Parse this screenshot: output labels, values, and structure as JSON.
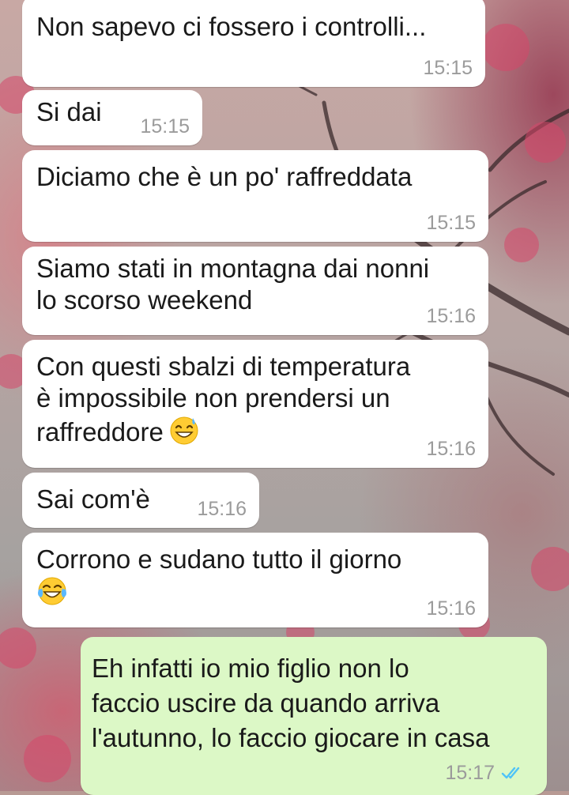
{
  "messages": [
    {
      "text": "Non sapevo ci fossero i controlli...",
      "time": "15:15"
    },
    {
      "text": "Si dai",
      "time": "15:15"
    },
    {
      "text": "Diciamo che è un po' raffreddata",
      "time": "15:15"
    },
    {
      "text": "Siamo stati in montagna dai nonni\nlo scorso weekend",
      "time": "15:16"
    },
    {
      "text": "Con questi sbalzi di temperatura\nè impossibile non prendersi un\nraffreddore",
      "emoji": "grinning-sweat-emoji",
      "time": "15:16"
    },
    {
      "text": "Sai com'è",
      "time": "15:16"
    },
    {
      "text": "Corrono e sudano tutto il giorno",
      "emoji": "tears-of-joy-emoji",
      "time": "15:16"
    },
    {
      "text": "Eh infatti io mio figlio non lo\nfaccio uscire da quando arriva\nl'autunno, lo faccio giocare in casa",
      "time": "15:17",
      "status": "read-double-check-icon"
    }
  ],
  "colors": {
    "incoming_bubble": "#ffffff",
    "outgoing_bubble": "#dcf8c6",
    "timestamp": "#9b9b9b",
    "read_tick": "#4fc3f7"
  }
}
